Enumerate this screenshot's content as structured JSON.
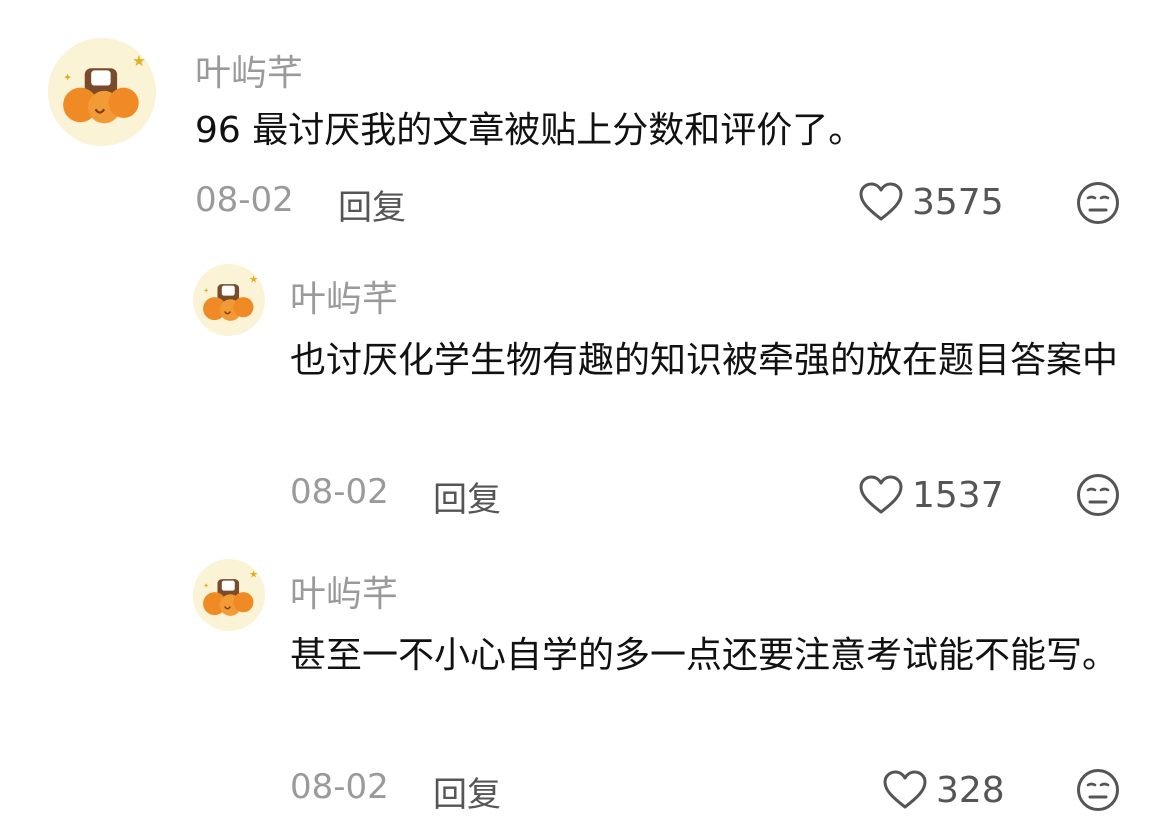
{
  "comments": [
    {
      "user": "叶屿芊",
      "text": "96 最讨厌我的文章被贴上分数和评价了。",
      "date": "08-02",
      "reply_label": "回复",
      "likes": "3575"
    },
    {
      "user": "叶屿芊",
      "text": "也讨厌化学生物有趣的知识被牵强的放在题目答案中",
      "date": "08-02",
      "reply_label": "回复",
      "likes": "1537"
    },
    {
      "user": "叶屿芊",
      "text": "甚至一不小心自学的多一点还要注意考试能不能写。",
      "date": "08-02",
      "reply_label": "回复",
      "likes": "328"
    }
  ],
  "colors": {
    "muted": "#9a9a9a",
    "text": "#111111",
    "icon": "#555555",
    "avatar_bg": "#fbf3d6",
    "avatar_orange": "#f08a24"
  },
  "icons": {
    "like": "heart-outline-icon",
    "dislike": "meh-face-icon",
    "avatar": "orange-puppy-avatar"
  }
}
